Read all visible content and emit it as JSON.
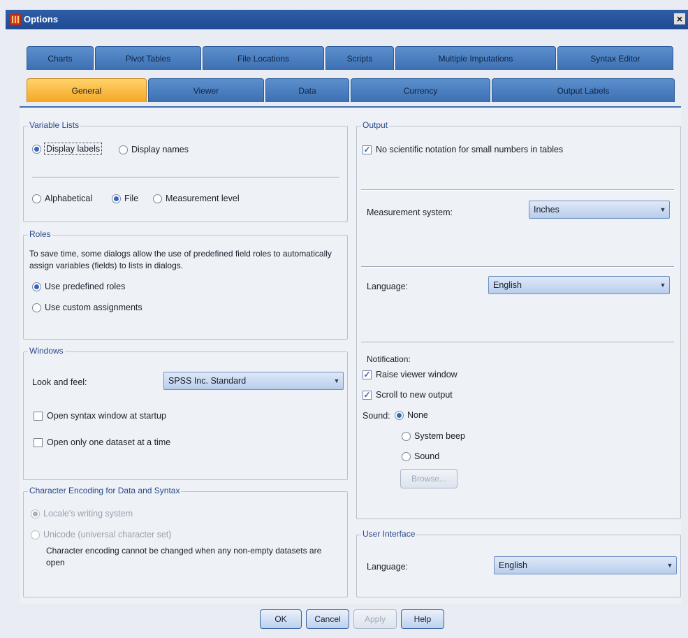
{
  "window": {
    "title": "Options",
    "close_label": "×"
  },
  "tabs_top": [
    "Charts",
    "Pivot Tables",
    "File Locations",
    "Scripts",
    "Multiple Imputations",
    "Syntax Editor"
  ],
  "tabs_bottom": [
    "General",
    "Viewer",
    "Data",
    "Currency",
    "Output Labels"
  ],
  "active_tab": "General",
  "variable_lists": {
    "legend": "Variable Lists",
    "display_labels": "Display labels",
    "display_names": "Display names",
    "alphabetical": "Alphabetical",
    "file": "File",
    "measurement_level": "Measurement level"
  },
  "roles": {
    "legend": "Roles",
    "description": "To save time, some dialogs allow the use of predefined field roles to automatically assign variables (fields) to lists in dialogs.",
    "use_predefined": "Use predefined roles",
    "use_custom": "Use custom assignments"
  },
  "windows": {
    "legend": "Windows",
    "look_label": "Look and feel:",
    "look_value": "SPSS Inc. Standard",
    "open_syntax": "Open syntax window at startup",
    "open_one_dataset": "Open only one dataset at a time"
  },
  "encoding": {
    "legend": "Character Encoding for Data and Syntax",
    "locale": "Locale's writing system",
    "unicode": "Unicode (universal character set)",
    "note": "Character encoding cannot be changed when any non-empty datasets are open"
  },
  "output": {
    "legend": "Output",
    "no_sci": "No scientific notation for small numbers in tables",
    "measurement_label": "Measurement system:",
    "measurement_value": "Inches",
    "language_label": "Language:",
    "language_value": "English",
    "notification_label": "Notification:",
    "raise_viewer": "Raise viewer window",
    "scroll_output": "Scroll to new output",
    "sound_label": "Sound:",
    "sound_none": "None",
    "sound_beep": "System beep",
    "sound_sound": "Sound",
    "browse": "Browse..."
  },
  "ui": {
    "legend": "User Interface",
    "language_label": "Language:",
    "language_value": "English"
  },
  "buttons": {
    "ok": "OK",
    "cancel": "Cancel",
    "apply": "Apply",
    "help": "Help"
  }
}
